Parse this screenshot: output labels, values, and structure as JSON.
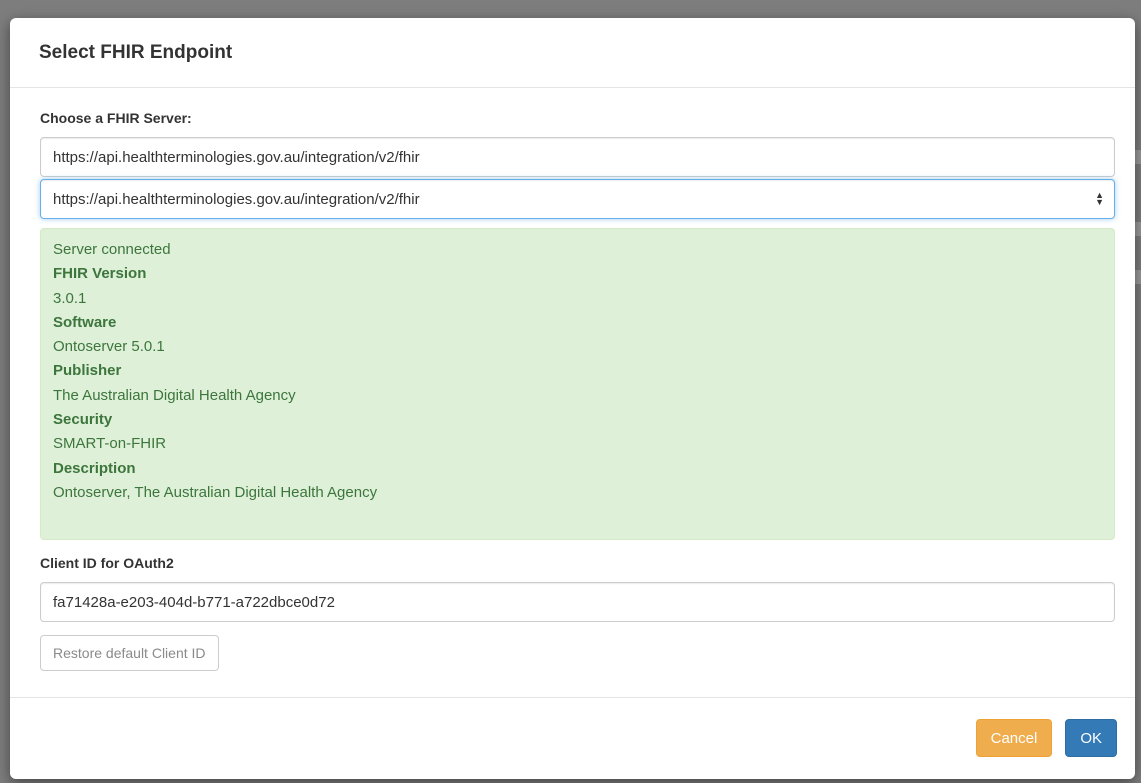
{
  "modal": {
    "title": "Select FHIR Endpoint"
  },
  "server": {
    "label": "Choose a FHIR Server:",
    "url_value": "https://api.healthterminologies.gov.au/integration/v2/fhir",
    "selected_option": "https://api.healthterminologies.gov.au/integration/v2/fhir"
  },
  "status": {
    "message": "Server connected",
    "fields": [
      {
        "key": "FHIR Version",
        "value": "3.0.1"
      },
      {
        "key": "Software",
        "value": "Ontoserver 5.0.1"
      },
      {
        "key": "Publisher",
        "value": "The Australian Digital Health Agency"
      },
      {
        "key": "Security",
        "value": "SMART-on-FHIR"
      },
      {
        "key": "Description",
        "value": "Ontoserver, The Australian Digital Health Agency"
      }
    ]
  },
  "client": {
    "label": "Client ID for OAuth2",
    "client_id_value": "fa71428a-e203-404d-b771-a722dbce0d72",
    "restore_label": "Restore default Client ID"
  },
  "footer": {
    "cancel_label": "Cancel",
    "ok_label": "OK"
  },
  "colors": {
    "success_bg": "#dff0d8",
    "success_text": "#3c763d",
    "warning": "#f0ad4e",
    "primary": "#337ab7"
  }
}
